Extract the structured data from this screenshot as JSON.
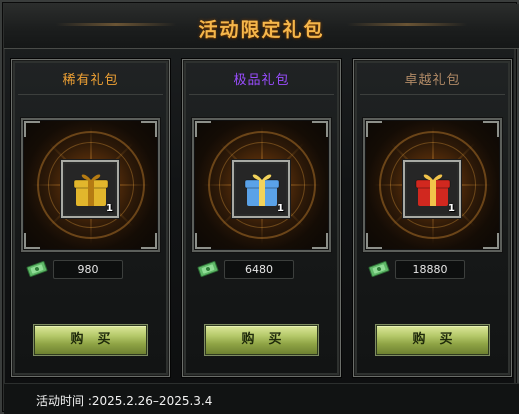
{
  "window": {
    "title": "活动限定礼包"
  },
  "packs": [
    {
      "title": "稀有礼包",
      "title_color": "#f0a234",
      "gift_color": "#e2b62c",
      "gift_ribbon": "#b57b12",
      "quantity": "1",
      "price": "980",
      "buy_label": "购买"
    },
    {
      "title": "极品礼包",
      "title_color": "#9a4dff",
      "gift_color": "#5aa2e8",
      "gift_ribbon": "#f2d35b",
      "quantity": "1",
      "price": "6480",
      "buy_label": "购买"
    },
    {
      "title": "卓越礼包",
      "title_color": "#b08a66",
      "gift_color": "#d1281f",
      "gift_ribbon": "#f1c34a",
      "quantity": "1",
      "price": "18880",
      "buy_label": "购买"
    }
  ],
  "footer": {
    "event_time": "活动时间 :2025.2.26–2025.3.4"
  },
  "icons": {
    "currency": "banknote-icon",
    "gift": "gift-box-icon"
  }
}
